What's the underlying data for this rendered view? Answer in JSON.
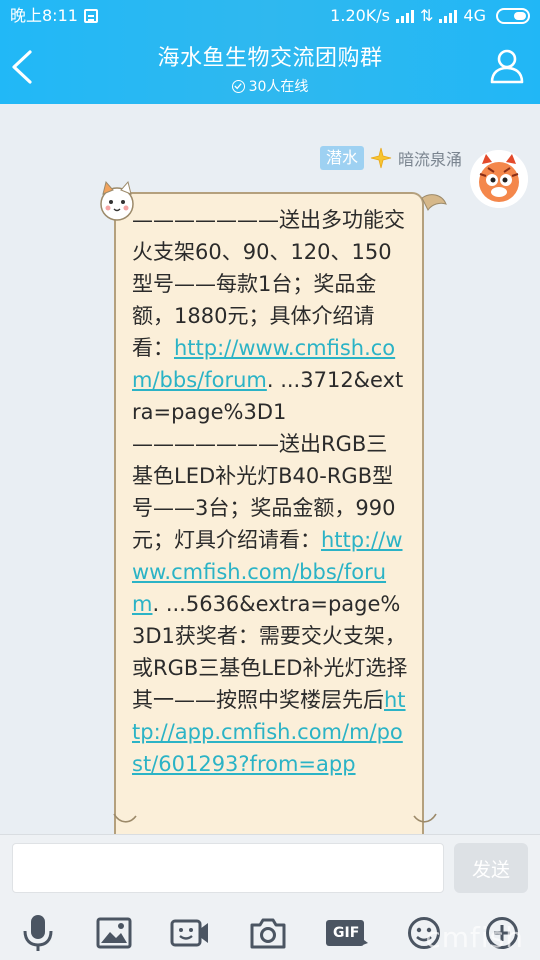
{
  "status": {
    "time": "晚上8:11",
    "speed": "1.20K/s",
    "network": "4G"
  },
  "header": {
    "title": "海水鱼生物交流团购群",
    "online": "30人在线"
  },
  "chat": {
    "sender_role": "潜水",
    "sender_name": "暗流泉涌",
    "message": {
      "p1": "———————送出多功能交火支架60、90、120、150型号——每款1台；奖品金额，1880元；具体介绍请看：",
      "link1": "http://www.cmfish.com/bbs/forum",
      "p2": ". ...3712&extra=page%3D1———————送出RGB三基色LED补光灯B40-RGB型号——3台；奖品金额，990元；灯具介绍请看：",
      "link2": "http://www.cmfish.com/bbs/forum",
      "p3": ". ...5636&extra=page%3D1获奖者：需要交火支架，或RGB三基色LED补光灯选择其一——按照中奖楼层先后",
      "link3": "http://app.cmfish.com/m/post/601293?from=app"
    }
  },
  "input": {
    "send_label": "发送",
    "value": ""
  },
  "toolbar": {
    "gif_label": "GIF"
  },
  "watermark": "cmfish",
  "colors": {
    "header_blue": "#21b8f7",
    "bubble_bg": "#fbefd9",
    "link": "#2bb3c6",
    "role_badge": "#9ed1f2"
  }
}
